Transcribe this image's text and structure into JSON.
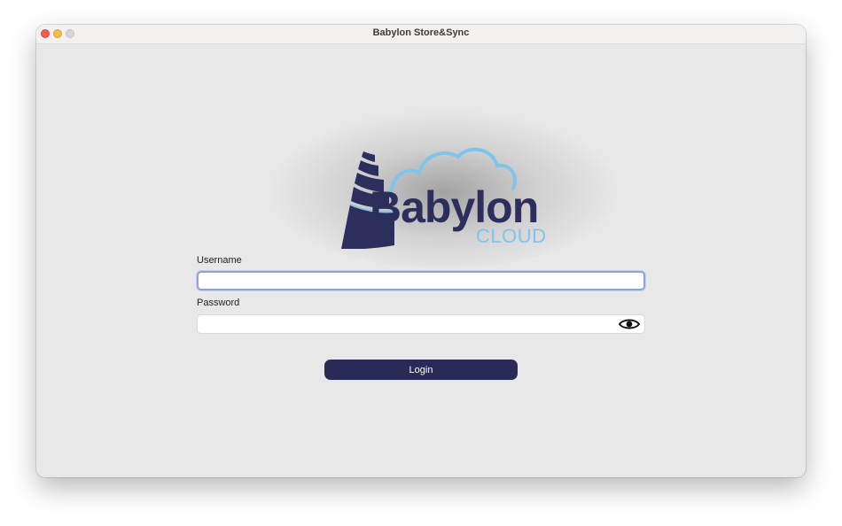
{
  "window": {
    "title": "Babylon Store&Sync"
  },
  "logo": {
    "brand": "Babylon",
    "subtitle": "CLOUD",
    "icon": "babylon-tower-cloud-logo",
    "colors": {
      "primary": "#2c2f5c",
      "accent": "#7fc4ec"
    }
  },
  "form": {
    "username_label": "Username",
    "username_value": "",
    "password_label": "Password",
    "password_value": "",
    "show_password_icon": "eye-icon",
    "login_label": "Login"
  },
  "colors": {
    "button": "#272b56",
    "focus_ring": "#8aa5e0",
    "window_bg": "#e8e8e8"
  }
}
